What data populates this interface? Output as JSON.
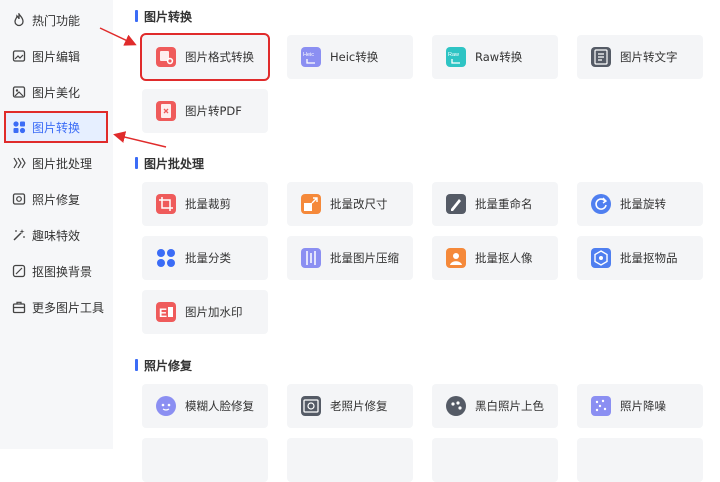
{
  "sidebar": {
    "items": [
      {
        "label": "热门功能",
        "icon": "flame-icon"
      },
      {
        "label": "图片编辑",
        "icon": "image-edit-icon"
      },
      {
        "label": "图片美化",
        "icon": "image-beautify-icon"
      },
      {
        "label": "图片转换",
        "icon": "convert-icon"
      },
      {
        "label": "图片批处理",
        "icon": "batch-icon"
      },
      {
        "label": "照片修复",
        "icon": "photo-repair-icon"
      },
      {
        "label": "趣味特效",
        "icon": "magic-wand-icon"
      },
      {
        "label": "抠图换背景",
        "icon": "cutout-icon"
      },
      {
        "label": "更多图片工具",
        "icon": "toolbox-icon"
      }
    ],
    "active_index": 3
  },
  "sections": [
    {
      "title": "图片转换",
      "cards": [
        {
          "label": "图片格式转换",
          "icon": "image-format-icon",
          "color": "#ef5b5b"
        },
        {
          "label": "Heic转换",
          "icon": "heic-file-icon",
          "color": "#8b8ff2"
        },
        {
          "label": "Raw转换",
          "icon": "raw-file-icon",
          "color": "#2ec4c4"
        },
        {
          "label": "图片转文字",
          "icon": "image-to-text-icon",
          "color": "#555b66"
        },
        {
          "label": "图片转PDF",
          "icon": "image-to-pdf-icon",
          "color": "#ef5b5b"
        }
      ]
    },
    {
      "title": "图片批处理",
      "cards": [
        {
          "label": "批量裁剪",
          "icon": "batch-crop-icon",
          "color": "#ef5b5b"
        },
        {
          "label": "批量改尺寸",
          "icon": "batch-resize-icon",
          "color": "#f5893a"
        },
        {
          "label": "批量重命名",
          "icon": "batch-rename-icon",
          "color": "#555b66"
        },
        {
          "label": "批量旋转",
          "icon": "batch-rotate-icon",
          "color": "#4f7ff0"
        },
        {
          "label": "批量分类",
          "icon": "batch-classify-icon",
          "color": "#3b6cf6"
        },
        {
          "label": "批量图片压缩",
          "icon": "batch-compress-icon",
          "color": "#8b8ff2"
        },
        {
          "label": "批量抠人像",
          "icon": "batch-portrait-icon",
          "color": "#f5893a"
        },
        {
          "label": "批量抠物品",
          "icon": "batch-object-icon",
          "color": "#4f7ff0"
        },
        {
          "label": "图片加水印",
          "icon": "watermark-icon",
          "color": "#ef5b5b"
        }
      ]
    },
    {
      "title": "照片修复",
      "cards": [
        {
          "label": "模糊人脸修复",
          "icon": "face-repair-icon",
          "color": "#8b8ff2"
        },
        {
          "label": "老照片修复",
          "icon": "old-photo-icon",
          "color": "#555b66"
        },
        {
          "label": "黑白照片上色",
          "icon": "colorize-icon",
          "color": "#555b66"
        },
        {
          "label": "照片降噪",
          "icon": "denoise-icon",
          "color": "#8b8ff2"
        }
      ]
    }
  ]
}
